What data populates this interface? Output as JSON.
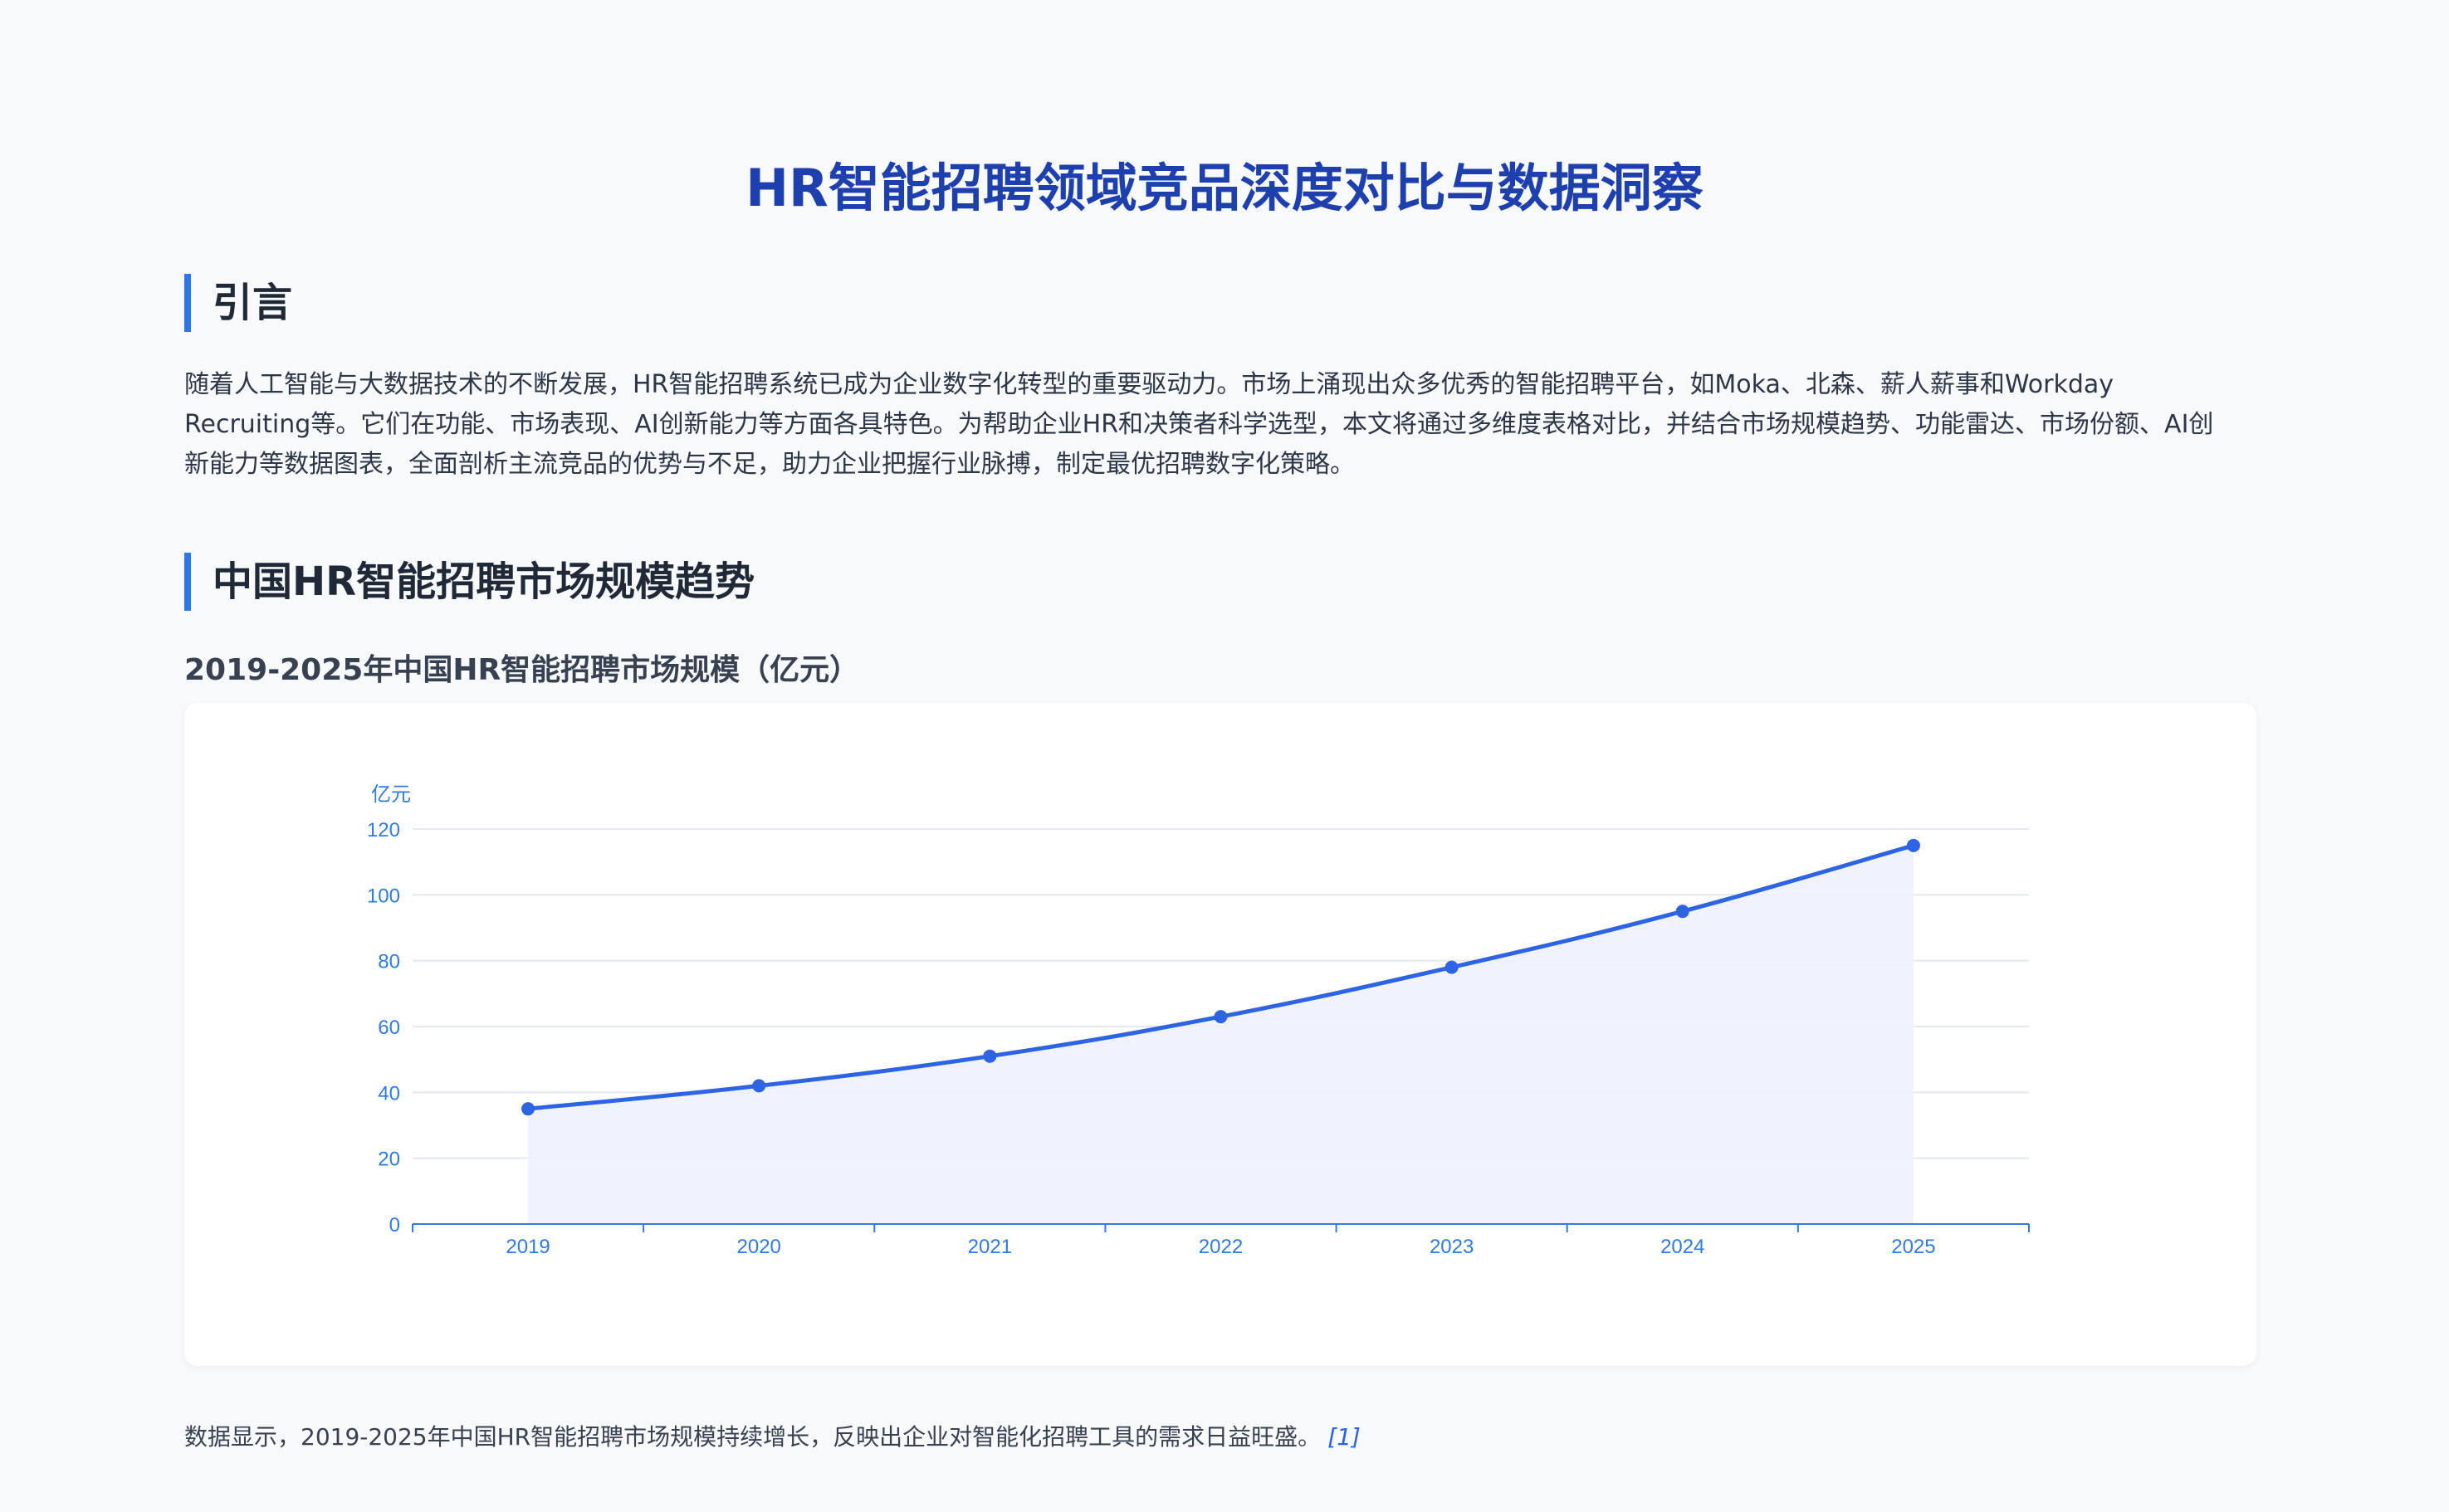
{
  "page": {
    "title": "HR智能招聘领域竞品深度对比与数据洞察"
  },
  "intro": {
    "heading": "引言",
    "paragraph": "随着人工智能与大数据技术的不断发展，HR智能招聘系统已成为企业数字化转型的重要驱动力。市场上涌现出众多优秀的智能招聘平台，如Moka、北森、薪人薪事和Workday Recruiting等。它们在功能、市场表现、AI创新能力等方面各具特色。为帮助企业HR和决策者科学选型，本文将通过多维度表格对比，并结合市场规模趋势、功能雷达、市场份额、AI创新能力等数据图表，全面剖析主流竞品的优势与不足，助力企业把握行业脉搏，制定最优招聘数字化策略。"
  },
  "market": {
    "heading": "中国HR智能招聘市场规模趋势",
    "chart_title": "2019-2025年中国HR智能招聘市场规模（亿元）",
    "footnote": "数据显示，2019-2025年中国HR智能招聘市场规模持续增长，反映出企业对智能化招聘工具的需求日益旺盛。",
    "footnote_ref": "[1]"
  },
  "colors": {
    "title": "#1e40af",
    "accent": "#2f74e8",
    "line": "#2c64e3",
    "area_fill": "#eef2fd",
    "axis_text": "#2f7be0",
    "grid": "#e3e8f2"
  },
  "chart_data": {
    "type": "area",
    "title": "2019-2025年中国HR智能招聘市场规模（亿元）",
    "x": [
      "2019",
      "2020",
      "2021",
      "2022",
      "2023",
      "2024",
      "2025"
    ],
    "values": [
      35,
      42,
      51,
      63,
      78,
      95,
      115
    ],
    "ylabel": "亿元",
    "xlabel": "",
    "ylim": [
      0,
      120
    ],
    "yticks": [
      0,
      20,
      40,
      60,
      80,
      100,
      120
    ],
    "grid": true,
    "legend": "none"
  }
}
